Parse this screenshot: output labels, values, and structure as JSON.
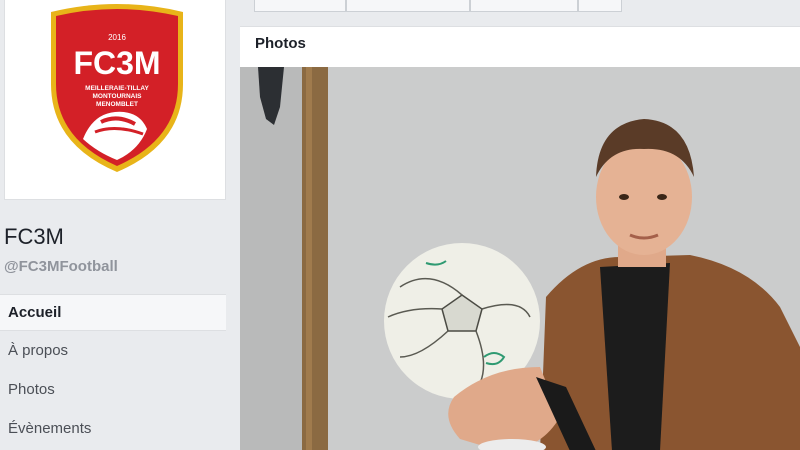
{
  "profile": {
    "logo_text": "FC3M",
    "logo_year": "2016",
    "logo_line1": "MEILLERAIE-TILLAY",
    "logo_line2": "MONTOURNAIS",
    "logo_line3": "MENOMBLET",
    "page_name": "FC3M",
    "handle": "@FC3MFootball"
  },
  "nav": {
    "items": [
      {
        "label": "Accueil",
        "active": true
      },
      {
        "label": "À propos"
      },
      {
        "label": "Photos"
      },
      {
        "label": "Évènements"
      }
    ]
  },
  "main": {
    "section_title": "Photos"
  },
  "colors": {
    "logo_red": "#d32027",
    "logo_gold": "#e8b419",
    "sidebar_bg": "#e9ebee",
    "text_gray": "#90949c"
  }
}
